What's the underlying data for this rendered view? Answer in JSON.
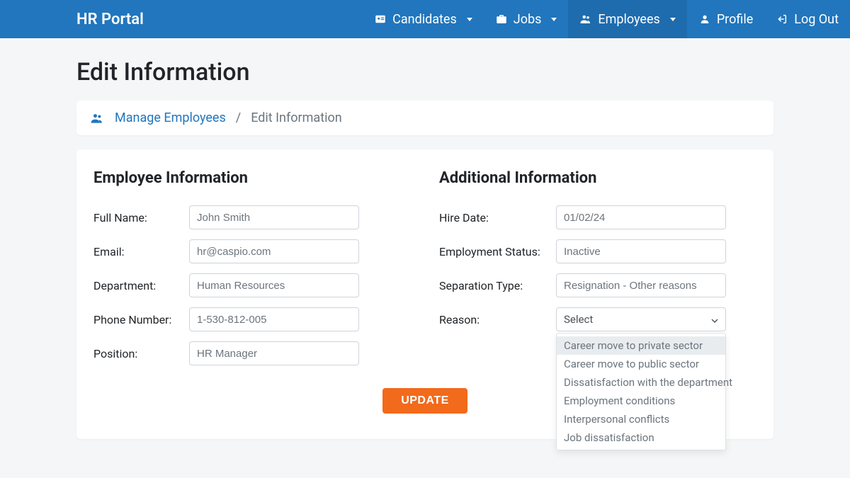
{
  "nav": {
    "brand": "HR Portal",
    "candidates": "Candidates",
    "jobs": "Jobs",
    "employees": "Employees",
    "profile": "Profile",
    "logout": "Log Out"
  },
  "page": {
    "title": "Edit Information"
  },
  "breadcrumb": {
    "link": "Manage Employees",
    "sep": "/",
    "current": "Edit Information"
  },
  "sections": {
    "employee": "Employee Information",
    "additional": "Additional Information"
  },
  "labels": {
    "full_name": "Full Name:",
    "email": "Email:",
    "department": "Department:",
    "phone": "Phone Number:",
    "position": "Position:",
    "hire_date": "Hire Date:",
    "employment_status": "Employment Status:",
    "separation_type": "Separation Type:",
    "reason": "Reason:"
  },
  "values": {
    "full_name": "John Smith",
    "email": "hr@caspio.com",
    "department": "Human Resources",
    "phone": "1-530-812-005",
    "position": "HR Manager",
    "hire_date": "01/02/24",
    "employment_status": "Inactive",
    "separation_type": "Resignation - Other reasons",
    "reason_selected": "Select"
  },
  "reason_options": [
    "Career move to private sector",
    "Career move to public sector",
    "Dissatisfaction with the department",
    "Employment conditions",
    "Interpersonal conflicts",
    "Job dissatisfaction"
  ],
  "buttons": {
    "update": "UPDATE"
  },
  "colors": {
    "primary": "#2176bd",
    "accent": "#f26a1b"
  }
}
